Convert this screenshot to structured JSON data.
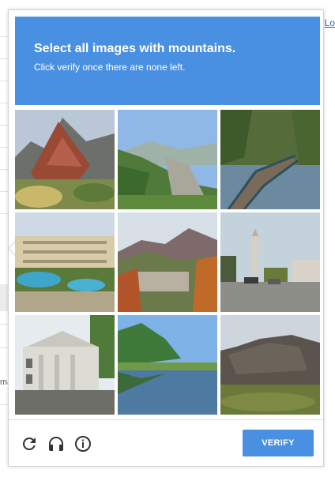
{
  "background": {
    "right_link": "Lo",
    "left_text": "ma"
  },
  "challenge": {
    "prompt_prefix": "Select all images with ",
    "prompt_keyword": "mountains.",
    "instruction": "Click verify once there are none left.",
    "tiles": [
      {
        "index": 1,
        "scene": "red-rock mountain with bushes"
      },
      {
        "index": 2,
        "scene": "green forested mountain slopes"
      },
      {
        "index": 3,
        "scene": "boardwalk bridge over water"
      },
      {
        "index": 4,
        "scene": "resort hotel with pools"
      },
      {
        "index": 5,
        "scene": "mountain valley town in autumn"
      },
      {
        "index": 6,
        "scene": "city street with tower"
      },
      {
        "index": 7,
        "scene": "white neoclassical building"
      },
      {
        "index": 8,
        "scene": "calm lake with trees"
      },
      {
        "index": 9,
        "scene": "rocky cliff outcrop"
      }
    ],
    "footer": {
      "reload_icon": "reload-icon",
      "audio_icon": "headphones-icon",
      "info_icon": "info-icon",
      "verify_label": "VERIFY"
    },
    "colors": {
      "accent": "#4a90e2"
    }
  }
}
